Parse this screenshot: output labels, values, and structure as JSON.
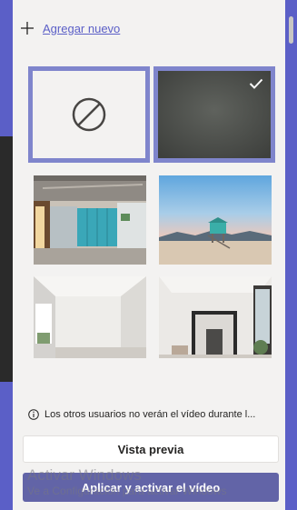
{
  "add_new": {
    "label": "Agregar nuevo"
  },
  "backgrounds": [
    {
      "name": "none",
      "selected": false
    },
    {
      "name": "blur",
      "selected": true
    },
    {
      "name": "office",
      "selected": false
    },
    {
      "name": "beach",
      "selected": false
    },
    {
      "name": "room-1",
      "selected": false
    },
    {
      "name": "room-2",
      "selected": false
    }
  ],
  "notice": {
    "text": "Los otros usuarios no verán el vídeo durante l..."
  },
  "buttons": {
    "preview": "Vista previa",
    "apply": "Aplicar y activar el vídeo"
  },
  "watermark": {
    "title": "Activar Windows",
    "subtitle": "Ve a Configuración para activar Windows"
  },
  "colors": {
    "accent": "#6264a7",
    "selection_border": "#7f85cc",
    "panel_bg": "#f3f2f1"
  }
}
